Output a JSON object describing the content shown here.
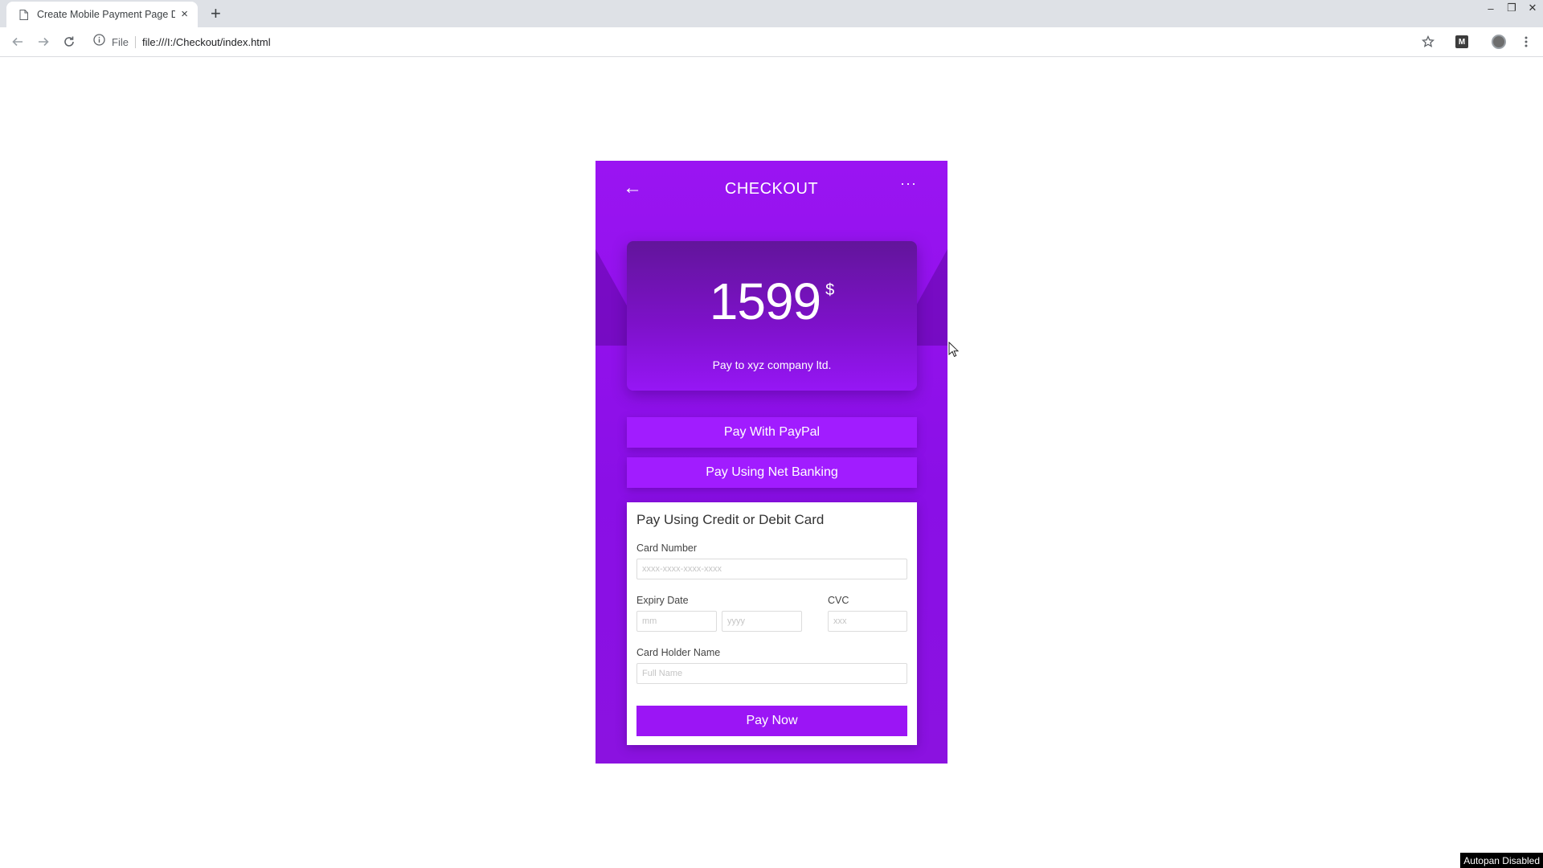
{
  "browser": {
    "tab_title": "Create Mobile Payment Page De",
    "tab_close": "×",
    "new_tab": "+",
    "address_scheme": "File",
    "address_url": "file:///I:/Checkout/index.html",
    "window_controls": [
      "–",
      "❐",
      "✕"
    ]
  },
  "checkout": {
    "back_symbol": "←",
    "title": "CHECKOUT",
    "more_symbol": "···",
    "amount": "1599",
    "currency": "$",
    "payee": "Pay to xyz company ltd.",
    "paypal_label": "Pay With PayPal",
    "netbanking_label": "Pay Using Net Banking",
    "card_section_title": "Pay Using Credit or Debit Card",
    "card_number_label": "Card Number",
    "card_number_placeholder": "xxxx-xxxx-xxxx-xxxx",
    "expiry_label": "Expiry Date",
    "expiry_month_placeholder": "mm",
    "expiry_year_placeholder": "yyyy",
    "cvc_label": "CVC",
    "cvc_placeholder": "xxx",
    "holder_label": "Card Holder Name",
    "holder_placeholder": "Full Name",
    "pay_now_label": "Pay Now"
  },
  "status": {
    "autopan": "Autopan Disabled"
  },
  "colors": {
    "brand_purple": "#9a14f2",
    "button_purple": "#a11cff"
  }
}
